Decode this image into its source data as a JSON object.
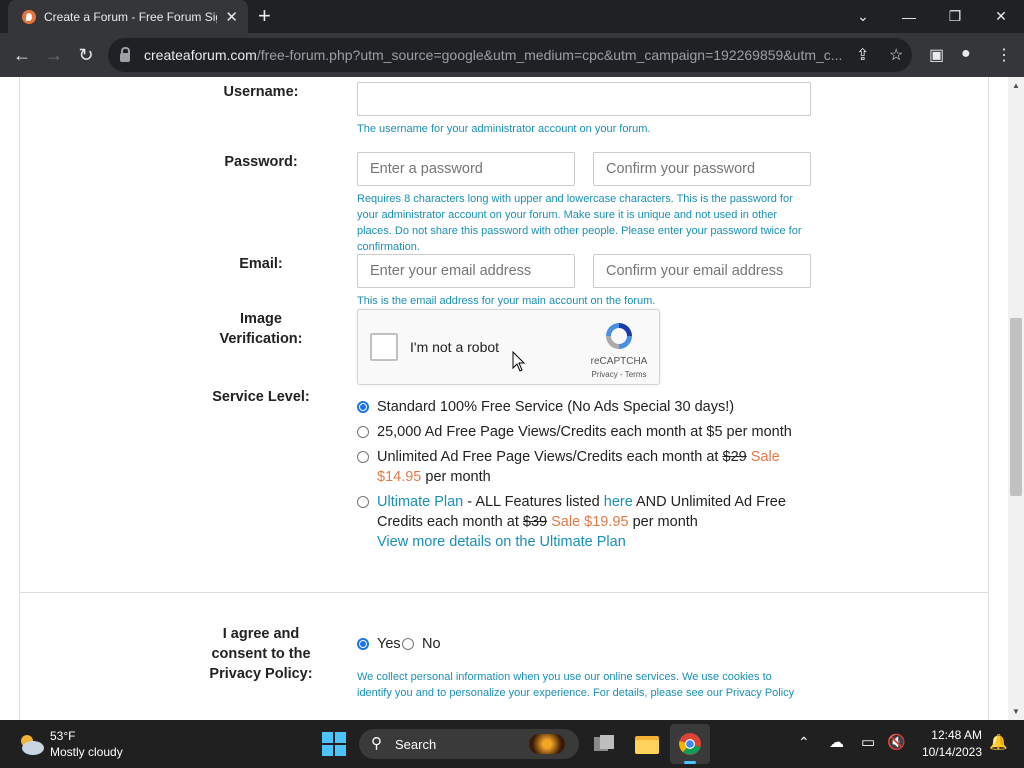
{
  "browser": {
    "tab_title": "Create a Forum - Free Forum Sig",
    "url_host": "createaforum.com",
    "url_path": "/free-forum.php?utm_source=google&utm_medium=cpc&utm_campaign=192269859&utm_c..."
  },
  "form": {
    "username": {
      "label": "Username:",
      "value": "",
      "help": "The username for your administrator account on your forum."
    },
    "password": {
      "label": "Password:",
      "placeholder": "Enter a password",
      "confirm_placeholder": "Confirm your password",
      "help": "Requires 8 characters long with upper and lowercase characters. This is the password for your administrator account on your forum. Make sure it is unique and not used in other places. Do not share this password with other people. Please enter your password twice for confirmation."
    },
    "email": {
      "label": "Email:",
      "placeholder": "Enter your email address",
      "confirm_placeholder": "Confirm your email address",
      "help": "This is the email address for your main account on the forum."
    },
    "image_verification": {
      "label_line1": "Image",
      "label_line2": "Verification:",
      "captcha_text": "I'm not a robot",
      "captcha_brand": "reCAPTCHA",
      "captcha_links": "Privacy - Terms"
    },
    "service_level": {
      "label": "Service Level:",
      "options": [
        {
          "text": "Standard 100% Free Service (No Ads Special 30 days!)",
          "checked": true
        },
        {
          "text": "25,000 Ad Free Page Views/Credits each month at $5 per month",
          "checked": false
        },
        {
          "part1": "Unlimited Ad Free Page Views/Credits each month at",
          "old_price": "$29",
          "sale": "Sale",
          "sale_price": "$14.95",
          "suffix": "per month",
          "checked": false
        },
        {
          "plan_link": "Ultimate Plan",
          "part1": "- ALL Features listed",
          "here_link": "here",
          "part2": "AND Unlimited Ad Free Credits each month at",
          "old_price": "$39",
          "sale": "Sale $19.95",
          "suffix": "per month",
          "details_link": "View more details on the Ultimate Plan",
          "checked": false
        }
      ]
    },
    "privacy": {
      "label_line1": "I agree and",
      "label_line2": "consent to the",
      "label_line3": "Privacy Policy:",
      "yes": "Yes",
      "no": "No",
      "yes_checked": true,
      "help": "We collect personal information when you use our online services. We use cookies to identify you and to personalize your experience. For details, please see our Privacy Policy"
    }
  },
  "taskbar": {
    "temperature": "53°F",
    "weather": "Mostly cloudy",
    "search": "Search",
    "time": "12:48 AM",
    "date": "10/14/2023"
  },
  "colors": {
    "link": "#1a8fb5",
    "sale": "#e07a47",
    "radio_checked": "#1a73e8"
  }
}
